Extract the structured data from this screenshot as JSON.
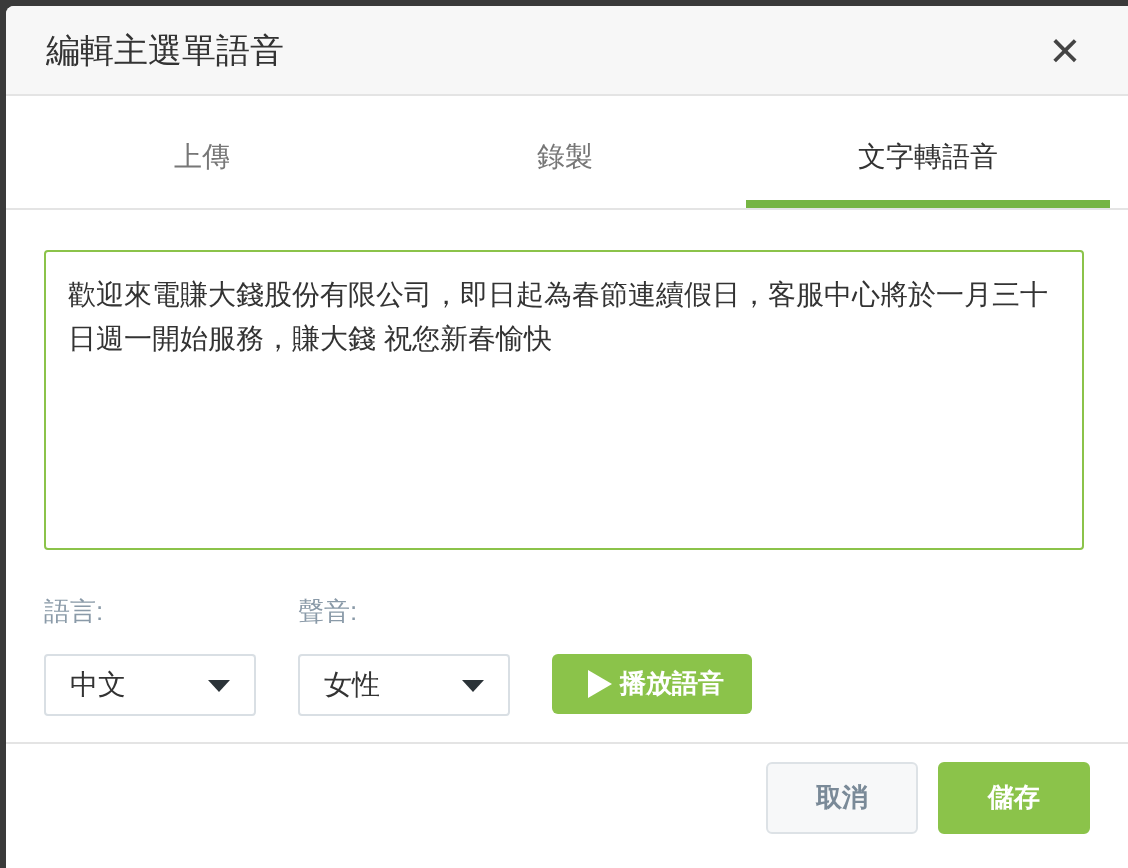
{
  "dialog": {
    "title": "編輯主選單語音",
    "close": "×"
  },
  "tabs": [
    {
      "label": "上傳",
      "selected": false
    },
    {
      "label": "錄製",
      "selected": false
    },
    {
      "label": "文字轉語音",
      "selected": true
    }
  ],
  "text_input": {
    "value": "歡迎來電賺大錢股份有限公司，即日起為春節連續假日，客服中心將於一月三十日週一開始服務，賺大錢 祝您新春愉快"
  },
  "language": {
    "label": "語言:",
    "value": "中文"
  },
  "voice": {
    "label": "聲音:",
    "value": "女性"
  },
  "play_button": {
    "label": "播放語音"
  },
  "buttons": [
    {
      "label": "取消",
      "kind": "secondary"
    },
    {
      "label": "儲存",
      "kind": "primary"
    }
  ]
}
